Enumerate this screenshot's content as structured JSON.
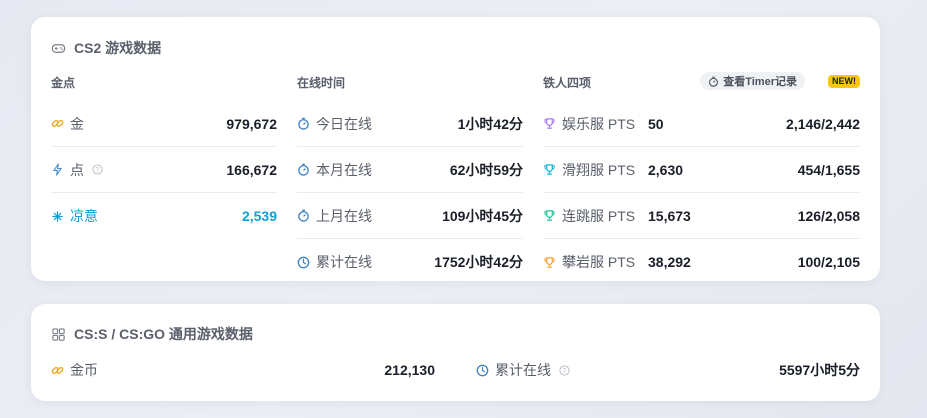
{
  "cs2": {
    "title": "CS2 游戏数据",
    "gold": {
      "heading": "金点",
      "items": [
        {
          "label": "金",
          "value": "979,672"
        },
        {
          "label": "点",
          "value": "166,672"
        },
        {
          "label": "凉意",
          "value": "2,539"
        }
      ]
    },
    "online": {
      "heading": "在线时间",
      "items": [
        {
          "label": "今日在线",
          "value": "1小时42分"
        },
        {
          "label": "本月在线",
          "value": "62小时59分"
        },
        {
          "label": "上月在线",
          "value": "109小时45分"
        },
        {
          "label": "累计在线",
          "value": "1752小时42分"
        }
      ]
    },
    "iron": {
      "heading": "铁人四项",
      "timer_button": "查看Timer记录",
      "new_badge": "NEW!",
      "items": [
        {
          "label": "娱乐服 PTS",
          "pts": "50",
          "rank": "2,146/2,442",
          "color": "#a67cf0"
        },
        {
          "label": "滑翔服 PTS",
          "pts": "2,630",
          "rank": "454/1,655",
          "color": "#14b4d6"
        },
        {
          "label": "连跳服 PTS",
          "pts": "15,673",
          "rank": "126/2,058",
          "color": "#22c19a"
        },
        {
          "label": "攀岩服 PTS",
          "pts": "38,292",
          "rank": "100/2,105",
          "color": "#f3a33a"
        }
      ]
    }
  },
  "css_go": {
    "title": "CS:S / CS:GO 通用游戏数据",
    "coins_label": "金币",
    "coins_value": "212,130",
    "online_label": "累计在线",
    "online_value": "5597小时5分"
  },
  "colors": {
    "gold_icon": "#e9a92c",
    "lightning_icon": "#4e8fd8",
    "accent": "#0ea0d8",
    "clock_icon": "#3d82c4"
  }
}
